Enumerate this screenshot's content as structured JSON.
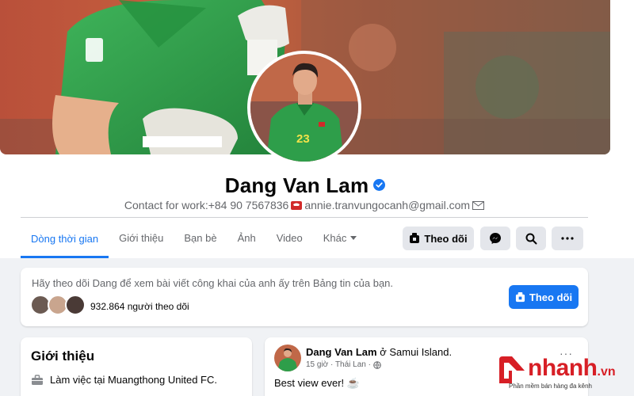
{
  "profile": {
    "name": "Dang Van Lam",
    "verified": true,
    "bio": {
      "contact_label": "Contact for work:+84 90 7567836",
      "email": "annie.tranvungocanh@gmail.com"
    }
  },
  "tabs": [
    {
      "label": "Dòng thời gian",
      "active": true
    },
    {
      "label": "Giới thiệu",
      "active": false
    },
    {
      "label": "Bạn bè",
      "active": false
    },
    {
      "label": "Ảnh",
      "active": false
    },
    {
      "label": "Video",
      "active": false
    },
    {
      "label": "Khác",
      "active": false
    }
  ],
  "actions": {
    "follow_label": "Theo dõi",
    "messenger_icon": "messenger-icon",
    "search_icon": "search-icon",
    "more_icon": "more-icon"
  },
  "follow_card": {
    "prompt": "Hãy theo dõi Dang để xem bài viết công khai của anh ấy trên Bảng tin của bạn.",
    "followers": "932.864 người theo dõi",
    "button_label": "Theo dõi"
  },
  "intro": {
    "title": "Giới thiệu",
    "work": "Làm việc tại Muangthong United FC."
  },
  "post": {
    "author": "Dang Van Lam",
    "location": "ở Samui Island.",
    "time": "15 giờ · Thái Lan ·",
    "text": "Best view ever! ☕",
    "more": "···"
  },
  "watermark": {
    "brand": "nhanh",
    "tld": ".vn",
    "tagline": "Phần mềm bán hàng đa kênh"
  },
  "colors": {
    "accent": "#1877f2",
    "background": "#f0f2f5",
    "secondary_text": "#65676b",
    "button_gray": "#e4e6eb",
    "jersey_green": "#2e9e4a",
    "watermark_red": "#d71f26"
  }
}
